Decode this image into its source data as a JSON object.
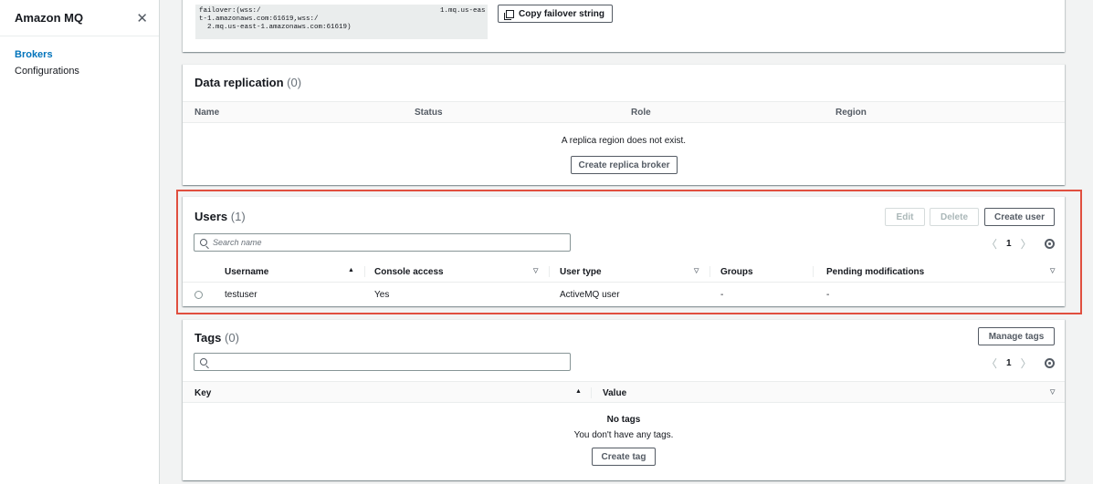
{
  "sidebar": {
    "title": "Amazon MQ",
    "close_icon": "✕",
    "items": [
      {
        "label": "Brokers",
        "active": true
      },
      {
        "label": "Configurations",
        "active": false
      }
    ]
  },
  "connection": {
    "failover_line1": "failover:(wss:/",
    "failover_line2": "t-1.amazonaws.com:61619,wss:/",
    "failover_line3": "  2.mq.us-east-1.amazonaws.com:61619)",
    "failover_part2": "1.mq.us-eas",
    "copy_label": "Copy failover string"
  },
  "replication": {
    "title": "Data replication",
    "count": "(0)",
    "columns": [
      "Name",
      "Status",
      "Role",
      "Region"
    ],
    "empty_message": "A replica region does not exist.",
    "create_label": "Create replica broker"
  },
  "users": {
    "title": "Users",
    "count": "(1)",
    "edit_label": "Edit",
    "delete_label": "Delete",
    "create_label": "Create user",
    "search_placeholder": "Search name",
    "page": "1",
    "columns": [
      "Username",
      "Console access",
      "User type",
      "Groups",
      "Pending modifications"
    ],
    "rows": [
      {
        "username": "testuser",
        "console_access": "Yes",
        "user_type": "ActiveMQ user",
        "groups": "-",
        "pending": "-"
      }
    ]
  },
  "tags": {
    "title": "Tags",
    "count": "(0)",
    "manage_label": "Manage tags",
    "search_placeholder": "",
    "page": "1",
    "columns": [
      "Key",
      "Value"
    ],
    "empty_title": "No tags",
    "empty_message": "You don't have any tags.",
    "create_label": "Create tag"
  },
  "colors": {
    "highlight": "#e04f3f",
    "link": "#0073bb"
  }
}
